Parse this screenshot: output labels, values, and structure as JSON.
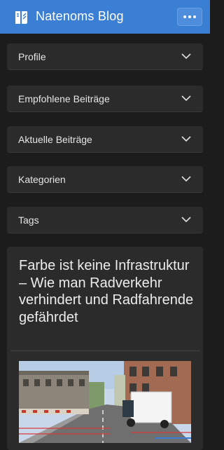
{
  "header": {
    "site_title": "Natenoms Blog",
    "logo_icon": "book-logo-icon",
    "menu_icon": "more-dots-icon",
    "accent_color": "#3b7fd4"
  },
  "sidebar": {
    "panels": [
      {
        "label": "Profile"
      },
      {
        "label": "Empfohlene Beiträge"
      },
      {
        "label": "Aktuelle Beiträge"
      },
      {
        "label": "Kategorien"
      },
      {
        "label": "Tags"
      }
    ]
  },
  "article": {
    "title": "Farbe ist keine Infrastruktur – Wie man Radverkehr verhindert und Radfahrende gefährdet"
  }
}
